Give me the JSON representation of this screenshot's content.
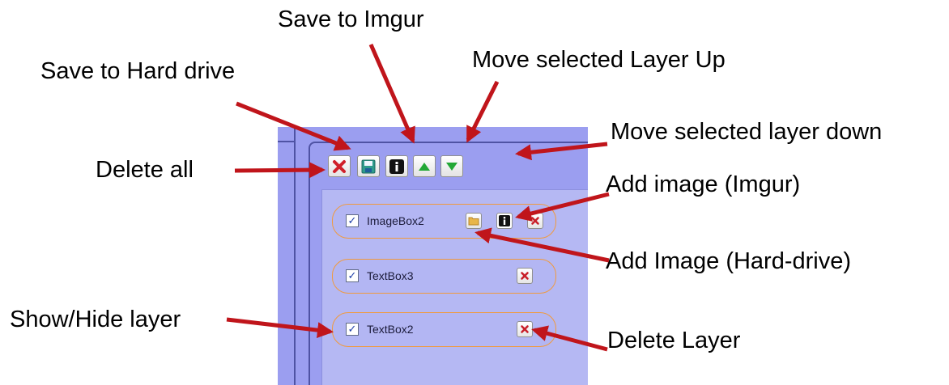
{
  "callouts": {
    "save_imgur": "Save to Imgur",
    "move_up": "Move selected Layer Up",
    "save_hd": "Save to Hard drive",
    "move_down": "Move selected layer down",
    "delete_all": "Delete all",
    "add_image_imgur": "Add image (Imgur)",
    "add_image_hd": "Add Image (Hard-drive)",
    "show_hide": "Show/Hide layer",
    "delete_layer": "Delete Layer"
  },
  "toolbar": {
    "buttons": [
      {
        "name": "delete-all-button",
        "icon": "red-x-icon"
      },
      {
        "name": "save-hard-drive-button",
        "icon": "floppy-disk-icon"
      },
      {
        "name": "save-imgur-button",
        "icon": "imgur-i-icon"
      },
      {
        "name": "move-layer-up-button",
        "icon": "green-up-triangle-icon"
      },
      {
        "name": "move-layer-down-button",
        "icon": "green-down-triangle-icon"
      }
    ]
  },
  "layers": [
    {
      "label": "ImageBox2",
      "visible": true,
      "kind": "image"
    },
    {
      "label": "TextBox3",
      "visible": true,
      "kind": "text"
    },
    {
      "label": "TextBox2",
      "visible": true,
      "kind": "text"
    }
  ],
  "colors": {
    "panel_bg": "#9b9ef0",
    "layer_border": "#f09a3e",
    "arrow": "#c0151b"
  }
}
